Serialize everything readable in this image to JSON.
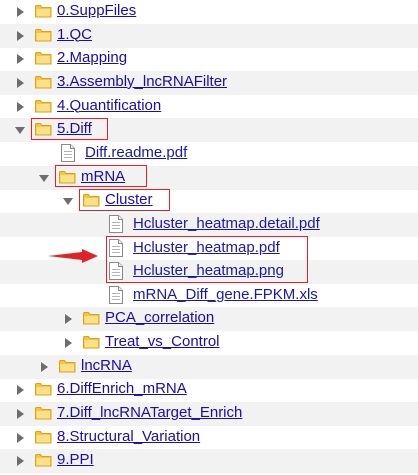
{
  "tree": {
    "items": [
      {
        "label": "0.SuppFiles",
        "type": "folder",
        "state": "collapsed",
        "level": 0
      },
      {
        "label": "1.QC",
        "type": "folder",
        "state": "collapsed",
        "level": 0
      },
      {
        "label": "2.Mapping",
        "type": "folder",
        "state": "collapsed",
        "level": 0
      },
      {
        "label": "3.Assembly_lncRNAFilter",
        "type": "folder",
        "state": "collapsed",
        "level": 0
      },
      {
        "label": "4.Quantification",
        "type": "folder",
        "state": "collapsed",
        "level": 0
      },
      {
        "label": "5.Diff",
        "type": "folder",
        "state": "expanded",
        "level": 0
      },
      {
        "label": "Diff.readme.pdf",
        "type": "file",
        "level": 1
      },
      {
        "label": "mRNA",
        "type": "folder",
        "state": "expanded",
        "level": 1
      },
      {
        "label": "Cluster",
        "type": "folder",
        "state": "expanded",
        "level": 2
      },
      {
        "label": "Hcluster_heatmap.detail.pdf",
        "type": "file",
        "level": 3
      },
      {
        "label": "Hcluster_heatmap.pdf",
        "type": "file",
        "level": 3
      },
      {
        "label": "Hcluster_heatmap.png",
        "type": "file",
        "level": 3
      },
      {
        "label": "mRNA_Diff_gene.FPKM.xls",
        "type": "file",
        "level": 3
      },
      {
        "label": "PCA_correlation",
        "type": "folder",
        "state": "collapsed",
        "level": 2
      },
      {
        "label": "Treat_vs_Control",
        "type": "folder",
        "state": "collapsed",
        "level": 2
      },
      {
        "label": "lncRNA",
        "type": "folder",
        "state": "collapsed",
        "level": 1
      },
      {
        "label": "6.DiffEnrich_mRNA",
        "type": "folder",
        "state": "collapsed",
        "level": 0
      },
      {
        "label": "7.Diff_lncRNATarget_Enrich",
        "type": "folder",
        "state": "collapsed",
        "level": 0
      },
      {
        "label": "8.Structural_Variation",
        "type": "folder",
        "state": "collapsed",
        "level": 0
      },
      {
        "label": "9.PPI",
        "type": "folder",
        "state": "collapsed",
        "level": 0
      }
    ]
  },
  "colors": {
    "link": "#1a0dab",
    "highlight": "#e0222b",
    "folder": "#f5c542",
    "row_shade": "#f2f2f2"
  }
}
